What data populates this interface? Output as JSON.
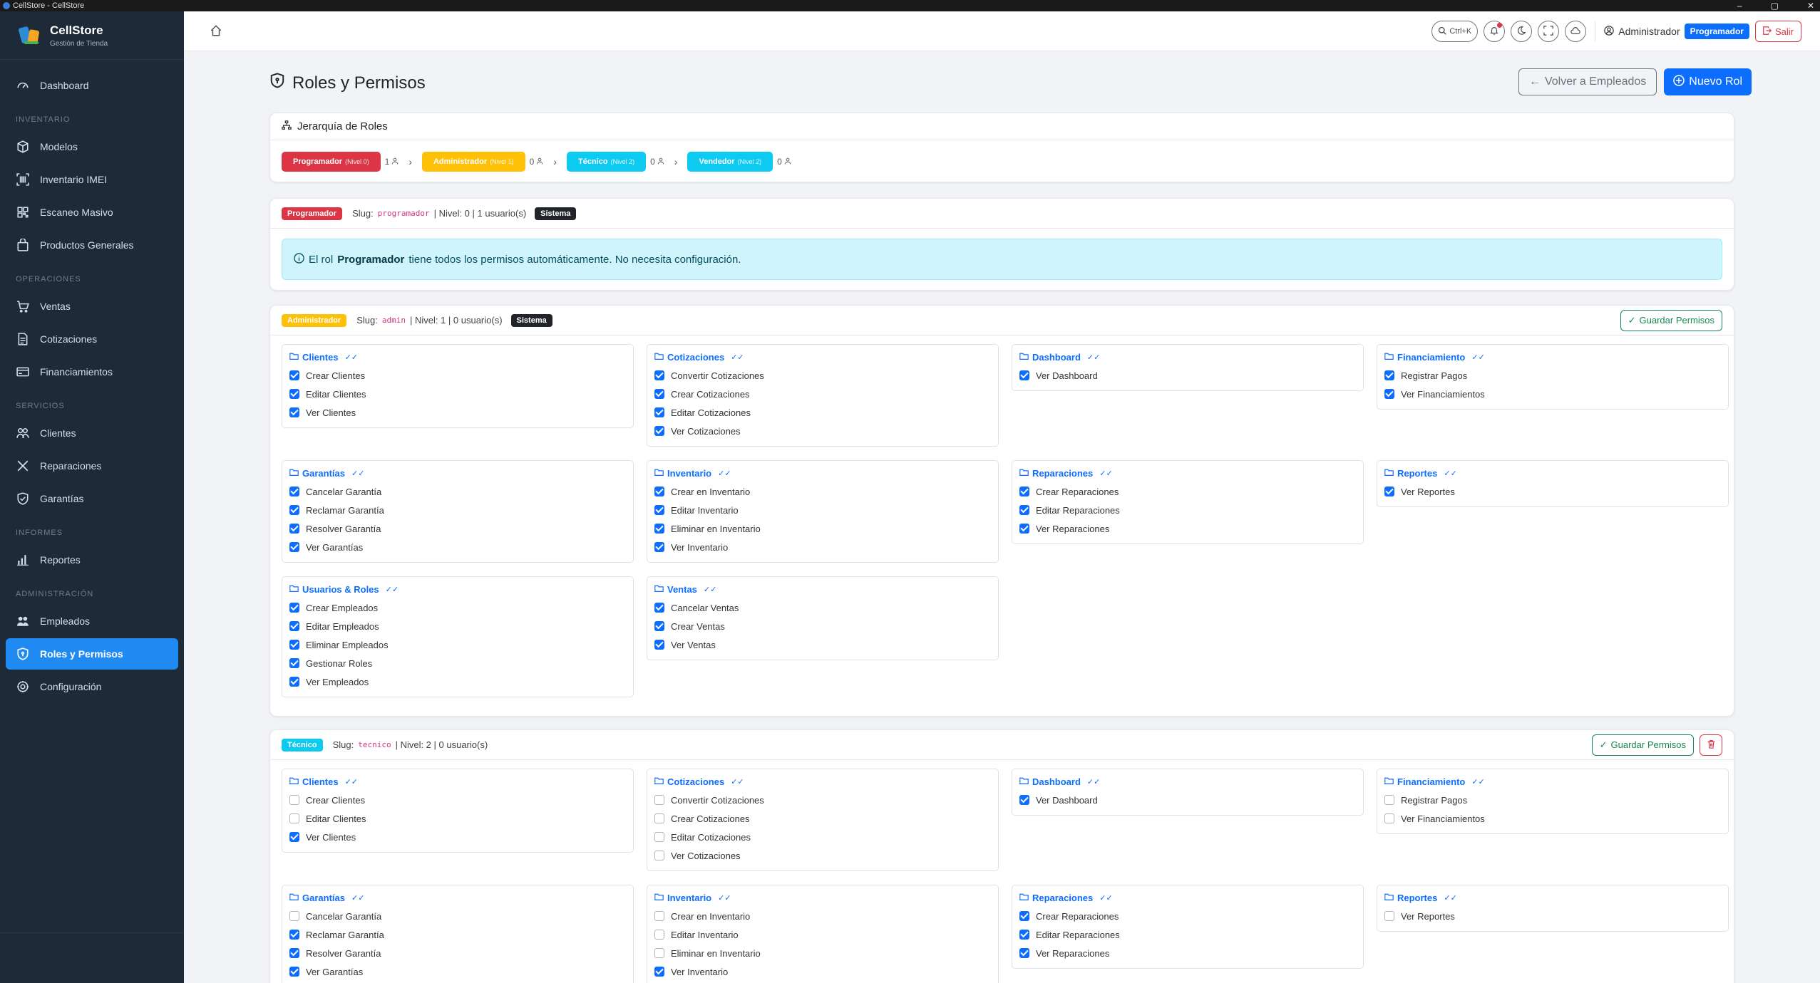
{
  "window": {
    "title": "CellStore - CellStore"
  },
  "brand": {
    "name": "CellStore",
    "subtitle": "Gestión de Tienda"
  },
  "nav": {
    "dashboard": "Dashboard",
    "sec_inventario": "INVENTARIO",
    "modelos": "Modelos",
    "inventario_imei": "Inventario IMEI",
    "escaneo_masivo": "Escaneo Masivo",
    "productos_generales": "Productos Generales",
    "sec_operaciones": "OPERACIONES",
    "ventas": "Ventas",
    "cotizaciones": "Cotizaciones",
    "financiamientos": "Financiamientos",
    "sec_servicios": "SERVICIOS",
    "clientes": "Clientes",
    "reparaciones": "Reparaciones",
    "garantias": "Garantías",
    "sec_informes": "INFORMES",
    "reportes": "Reportes",
    "sec_administracion": "ADMINISTRACIÓN",
    "empleados": "Empleados",
    "roles_permisos": "Roles y Permisos",
    "configuracion": "Configuración"
  },
  "topbar": {
    "shortcut": "Ctrl+K",
    "user_name": "Administrador",
    "user_role": "Programador",
    "logout": "Salir"
  },
  "page": {
    "title": "Roles y Permisos",
    "back_button": "Volver a Empleados",
    "new_role_button": "Nuevo Rol"
  },
  "hierarchy": {
    "title": "Jerarquía de Roles",
    "roles": [
      {
        "name": "Programador",
        "level": "(Nivel 0)",
        "count": "1",
        "color": "#dc3545"
      },
      {
        "name": "Administrador",
        "level": "(Nivel 1)",
        "count": "0",
        "color": "#ffc107"
      },
      {
        "name": "Técnico",
        "level": "(Nivel 2)",
        "count": "0",
        "color": "#0dcaf0"
      },
      {
        "name": "Vendedor",
        "level": "(Nivel 2)",
        "count": "0",
        "color": "#0dcaf0"
      }
    ]
  },
  "role_programador": {
    "badge": "Programador",
    "slug_label": "Slug:",
    "slug": "programador",
    "meta": "| Nivel: 0 | 1 usuario(s)",
    "system": "Sistema",
    "alert_pre": "El rol",
    "alert_role": "Programador",
    "alert_post": "tiene todos los permisos automáticamente. No necesita configuración."
  },
  "role_admin": {
    "badge": "Administrador",
    "slug_label": "Slug:",
    "slug": "admin",
    "meta": "| Nivel: 1 | 0 usuario(s)",
    "system": "Sistema",
    "save": "Guardar Permisos",
    "modules": {
      "clientes": {
        "title": "Clientes",
        "perms": [
          [
            "Crear Clientes",
            true
          ],
          [
            "Editar Clientes",
            true
          ],
          [
            "Ver Clientes",
            true
          ]
        ]
      },
      "cotizaciones": {
        "title": "Cotizaciones",
        "perms": [
          [
            "Convertir Cotizaciones",
            true
          ],
          [
            "Crear Cotizaciones",
            true
          ],
          [
            "Editar Cotizaciones",
            true
          ],
          [
            "Ver Cotizaciones",
            true
          ]
        ]
      },
      "dashboard": {
        "title": "Dashboard",
        "perms": [
          [
            "Ver Dashboard",
            true
          ]
        ]
      },
      "financiamiento": {
        "title": "Financiamiento",
        "perms": [
          [
            "Registrar Pagos",
            true
          ],
          [
            "Ver Financiamientos",
            true
          ]
        ]
      },
      "garantias": {
        "title": "Garantías",
        "perms": [
          [
            "Cancelar Garantía",
            true
          ],
          [
            "Reclamar Garantía",
            true
          ],
          [
            "Resolver Garantía",
            true
          ],
          [
            "Ver Garantías",
            true
          ]
        ]
      },
      "inventario": {
        "title": "Inventario",
        "perms": [
          [
            "Crear en Inventario",
            true
          ],
          [
            "Editar Inventario",
            true
          ],
          [
            "Eliminar en Inventario",
            true
          ],
          [
            "Ver Inventario",
            true
          ]
        ]
      },
      "reparaciones": {
        "title": "Reparaciones",
        "perms": [
          [
            "Crear Reparaciones",
            true
          ],
          [
            "Editar Reparaciones",
            true
          ],
          [
            "Ver Reparaciones",
            true
          ]
        ]
      },
      "reportes": {
        "title": "Reportes",
        "perms": [
          [
            "Ver Reportes",
            true
          ]
        ]
      },
      "usuarios": {
        "title": "Usuarios & Roles",
        "perms": [
          [
            "Crear Empleados",
            true
          ],
          [
            "Editar Empleados",
            true
          ],
          [
            "Eliminar Empleados",
            true
          ],
          [
            "Gestionar Roles",
            true
          ],
          [
            "Ver Empleados",
            true
          ]
        ]
      },
      "ventas": {
        "title": "Ventas",
        "perms": [
          [
            "Cancelar Ventas",
            true
          ],
          [
            "Crear Ventas",
            true
          ],
          [
            "Ver Ventas",
            true
          ]
        ]
      }
    }
  },
  "role_tecnico": {
    "badge": "Técnico",
    "slug_label": "Slug:",
    "slug": "tecnico",
    "meta": "| Nivel: 2 | 0 usuario(s)",
    "save": "Guardar Permisos",
    "modules": {
      "clientes": {
        "title": "Clientes",
        "perms": [
          [
            "Crear Clientes",
            false
          ],
          [
            "Editar Clientes",
            false
          ],
          [
            "Ver Clientes",
            true
          ]
        ]
      },
      "cotizaciones": {
        "title": "Cotizaciones",
        "perms": [
          [
            "Convertir Cotizaciones",
            false
          ],
          [
            "Crear Cotizaciones",
            false
          ],
          [
            "Editar Cotizaciones",
            false
          ],
          [
            "Ver Cotizaciones",
            false
          ]
        ]
      },
      "dashboard": {
        "title": "Dashboard",
        "perms": [
          [
            "Ver Dashboard",
            true
          ]
        ]
      },
      "financiamiento": {
        "title": "Financiamiento",
        "perms": [
          [
            "Registrar Pagos",
            false
          ],
          [
            "Ver Financiamientos",
            false
          ]
        ]
      },
      "garantias": {
        "title": "Garantías",
        "perms": [
          [
            "Cancelar Garantía",
            false
          ],
          [
            "Reclamar Garantía",
            true
          ],
          [
            "Resolver Garantía",
            true
          ],
          [
            "Ver Garantías",
            true
          ]
        ]
      },
      "inventario": {
        "title": "Inventario",
        "perms": [
          [
            "Crear en Inventario",
            false
          ],
          [
            "Editar Inventario",
            false
          ],
          [
            "Eliminar en Inventario",
            false
          ],
          [
            "Ver Inventario",
            true
          ]
        ]
      },
      "reparaciones": {
        "title": "Reparaciones",
        "perms": [
          [
            "Crear Reparaciones",
            true
          ],
          [
            "Editar Reparaciones",
            true
          ],
          [
            "Ver Reparaciones",
            true
          ]
        ]
      },
      "reportes": {
        "title": "Reportes",
        "perms": [
          [
            "Ver Reportes",
            false
          ]
        ]
      }
    }
  },
  "colors": {
    "sidebar_bg": "#1f2a38",
    "primary": "#0d6efd",
    "programador": "#dc3545",
    "administrador": "#ffc107",
    "tecnico": "#0dcaf0",
    "success": "#198754"
  }
}
